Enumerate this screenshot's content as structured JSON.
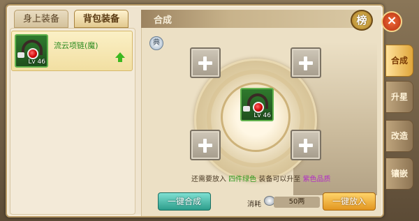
{
  "tabs": {
    "equipped": "身上装备",
    "bag": "背包装备"
  },
  "item": {
    "name": "流云项链(魔)",
    "level": "Lv 46"
  },
  "panel": {
    "title": "合成",
    "rank_label": "榜",
    "close_label": "×",
    "dict_label": "典"
  },
  "hint": {
    "prefix": "还需要放入",
    "green": "四件绿色",
    "middle": " 装备可以升至 ",
    "purple": "紫色品质"
  },
  "buttons": {
    "merge": "一键合成",
    "add": "一键放入"
  },
  "cost": {
    "label": "消耗",
    "value": "50两"
  },
  "side_tabs": [
    {
      "label": "合成",
      "active": true
    },
    {
      "label": "升星",
      "active": false
    },
    {
      "label": "改造",
      "active": false
    },
    {
      "label": "镶嵌",
      "active": false
    }
  ],
  "slots": {
    "plus": "+"
  }
}
